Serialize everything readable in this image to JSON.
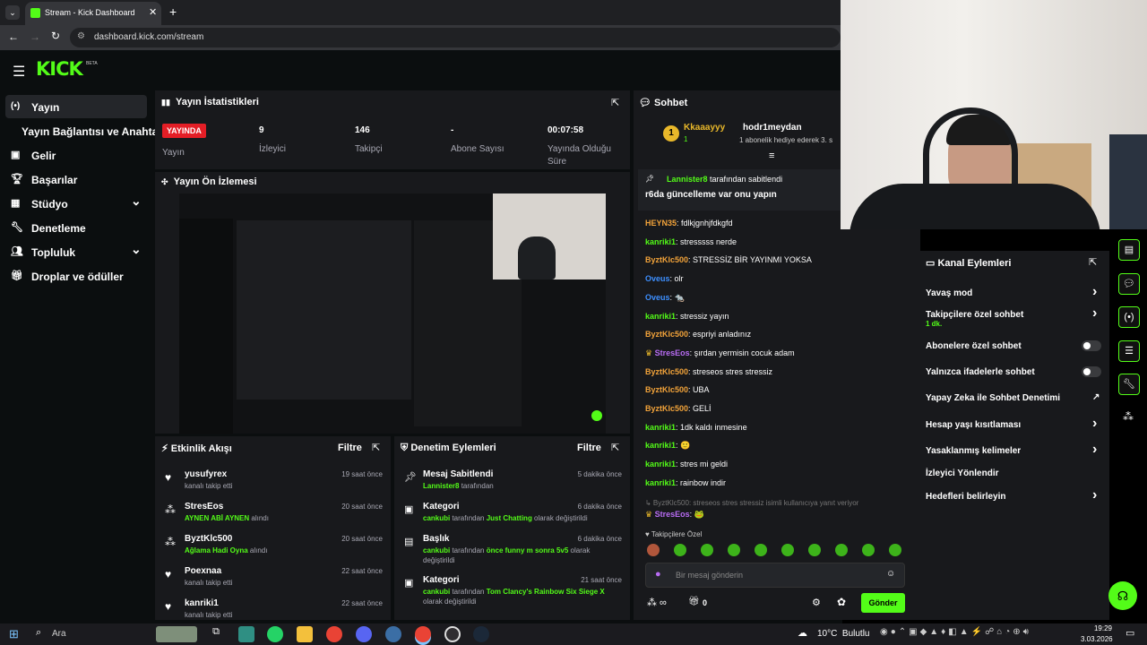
{
  "browser": {
    "tab_title": "Stream - Kick Dashboard",
    "url": "dashboard.kick.com/stream"
  },
  "brand": {
    "logo": "KICK",
    "beta": "BETA"
  },
  "sidebar": {
    "items": [
      {
        "label": "Yayın",
        "icon": "broadcast-icon",
        "active": true
      },
      {
        "label": "Yayın Bağlantısı ve Anahtarı",
        "icon": "",
        "active": false
      },
      {
        "label": "Gelir",
        "icon": "chart-icon",
        "active": false
      },
      {
        "label": "Başarılar",
        "icon": "trophy-icon",
        "active": false
      },
      {
        "label": "Stüdyo",
        "icon": "studio-icon",
        "active": false,
        "expand": "⌄"
      },
      {
        "label": "Denetleme",
        "icon": "wrench-icon",
        "active": false
      },
      {
        "label": "Topluluk",
        "icon": "community-icon",
        "active": false,
        "expand": "⌄"
      },
      {
        "label": "Droplar ve ödüller",
        "icon": "drops-icon",
        "active": false
      }
    ]
  },
  "stats": {
    "title": "Yayın İstatistikleri",
    "live_badge": "YAYINDA",
    "live_label": "Yayın",
    "viewers": {
      "value": "9",
      "label": "İzleyici"
    },
    "followers": {
      "value": "146",
      "label": "Takipçi"
    },
    "subs": {
      "value": "-",
      "label": "Abone Sayısı"
    },
    "uptime": {
      "value": "00:07:58",
      "label1": "Yayında Olduğu",
      "label2": "Süre"
    }
  },
  "preview": {
    "title": "Yayın Ön İzlemesi"
  },
  "activity": {
    "title": "Etkinlik Akışı",
    "filter": "Filtre",
    "events": [
      {
        "name": "yusufyrex",
        "time": "19 saat önce",
        "pre": "kanalı takip etti",
        "hl": "",
        "post": "",
        "icon": "heart-icon"
      },
      {
        "name": "StresEos",
        "time": "20 saat önce",
        "pre": "",
        "hl": "AYNEN ABİ AYNEN",
        "post": " alındı",
        "icon": "drops-icon"
      },
      {
        "name": "ByztKlc500",
        "time": "20 saat önce",
        "pre": "",
        "hl": "Ağlama Hadi Oyna",
        "post": " alındı",
        "icon": "drops-icon"
      },
      {
        "name": "Poexnaa",
        "time": "22 saat önce",
        "pre": "kanalı takip etti",
        "hl": "",
        "post": "",
        "icon": "heart-icon"
      },
      {
        "name": "kanriki1",
        "time": "22 saat önce",
        "pre": "kanalı takip etti",
        "hl": "",
        "post": "",
        "icon": "heart-icon"
      }
    ]
  },
  "moderation": {
    "title": "Denetim Eylemleri",
    "filter": "Filtre",
    "events": [
      {
        "name": "Mesaj Sabitlendi",
        "time": "5 dakika önce",
        "line1_user": "Lannister8",
        "line1_rest": " tarafından",
        "line2": "",
        "icon": "pin-icon"
      },
      {
        "name": "Kategori",
        "time": "6 dakika önce",
        "line1_user": "cankubi",
        "line1_rest": " tarafından ",
        "line1_hl": "Just Chatting",
        "line1_tail": " olarak değiştirildi",
        "line2": "",
        "icon": "category-icon"
      },
      {
        "name": "Başlık",
        "time": "6 dakika önce",
        "line1_user": "cankubi",
        "line1_rest": " tarafından ",
        "line1_hl": "önce funny m sonra 5v5",
        "line1_tail": " olarak",
        "line2": "değiştirildi",
        "icon": "title-icon"
      },
      {
        "name": "Kategori",
        "time": "21 saat önce",
        "line1_user": "cankubi",
        "line1_rest": " tarafından ",
        "line1_hl": "Tom Clancy's Rainbow Six Siege X",
        "line1_tail": "",
        "line2": "olarak değiştirildi",
        "icon": "category-icon"
      }
    ]
  },
  "chat": {
    "title": "Sohbet",
    "top_gifter": {
      "name": "Kkaaayyy",
      "rank": "1",
      "count": "1"
    },
    "gift": {
      "name": "hodr1meydan",
      "text": "1 abonelik hediye ederek 3. s"
    },
    "pinned": {
      "user": "Lannister8",
      "by": " tarafından sabitlendi",
      "message": "r6da güncelleme var onu yapın"
    },
    "messages": [
      {
        "user": "HEYN35",
        "color": "#f2a33a",
        "text": ": fdlkjgnhjfdkgfd"
      },
      {
        "user": "kanriki1",
        "color": "#53fc18",
        "text": ": stresssss nerde"
      },
      {
        "user": "ByztKlc500",
        "color": "#f2a33a",
        "text": ": STRESSİZ BİR YAYINMI YOKSA"
      },
      {
        "user": "Oveus",
        "color": "#3d8fff",
        "text": ": olr"
      },
      {
        "user": "Oveus",
        "color": "#3d8fff",
        "text": ": 🐀"
      },
      {
        "user": "kanriki1",
        "color": "#53fc18",
        "text": ": stressiz yayın"
      },
      {
        "user": "ByztKlc500",
        "color": "#f2a33a",
        "text": ": espriyi anladınız"
      },
      {
        "user": "StresEos",
        "color": "#b86cf3",
        "text": ": şırdan yermisin cocuk adam"
      },
      {
        "user": "ByztKlc500",
        "color": "#f2a33a",
        "text": ": streseos stres stressiz"
      },
      {
        "user": "ByztKlc500",
        "color": "#f2a33a",
        "text": ": UBA"
      },
      {
        "user": "ByztKlc500",
        "color": "#f2a33a",
        "text": ": GELİ"
      },
      {
        "user": "kanriki1",
        "color": "#53fc18",
        "text": ": 1dk kaldı inmesine"
      },
      {
        "user": "kanriki1",
        "color": "#53fc18",
        "text": ": 🙂"
      },
      {
        "user": "kanriki1",
        "color": "#53fc18",
        "text": ": stres mi geldi"
      },
      {
        "user": "kanriki1",
        "color": "#53fc18",
        "text": ": rainbow indir"
      }
    ],
    "reply": {
      "context": "↳ ByztKlc500: streseos stres stressiz isimli kullanıcıya yanıt veriyor",
      "user": "StresEos",
      "text": ": 🐸"
    },
    "follower_only": "Takipçilere Özel",
    "input_placeholder": "Bir mesaj gönderin",
    "send": "Gönder",
    "gift_count": "0"
  },
  "kanal": {
    "title": "Kanal Eylemleri",
    "rows": [
      {
        "label": "Yavaş mod",
        "sub": "",
        "control": "›"
      },
      {
        "label": "Takipçilere özel sohbet",
        "sub": "1 dk.",
        "control": "›"
      },
      {
        "label": "Abonelere özel sohbet",
        "sub": "",
        "control": "toggle"
      },
      {
        "label": "Yalnızca ifadelerle sohbet",
        "sub": "",
        "control": "toggle"
      },
      {
        "label": "Yapay Zeka ile Sohbet Denetimi",
        "sub": "",
        "control": "↗"
      },
      {
        "label": "Hesap yaşı kısıtlaması",
        "sub": "",
        "control": "›"
      },
      {
        "label": "Yasaklanmış kelimeler",
        "sub": "",
        "control": "›"
      },
      {
        "label": "İzleyici Yönlendir",
        "sub": "",
        "control": ""
      },
      {
        "label": "Hedefleri belirleyin",
        "sub": "",
        "control": "›"
      }
    ]
  },
  "taskbar": {
    "search": "Ara",
    "weather": "10°C  Bulutlu",
    "time": "19:29",
    "date": "3.03.2026"
  },
  "colors": {
    "accent": "#53fc18",
    "live": "#e41e26",
    "panel": "#18191c"
  }
}
